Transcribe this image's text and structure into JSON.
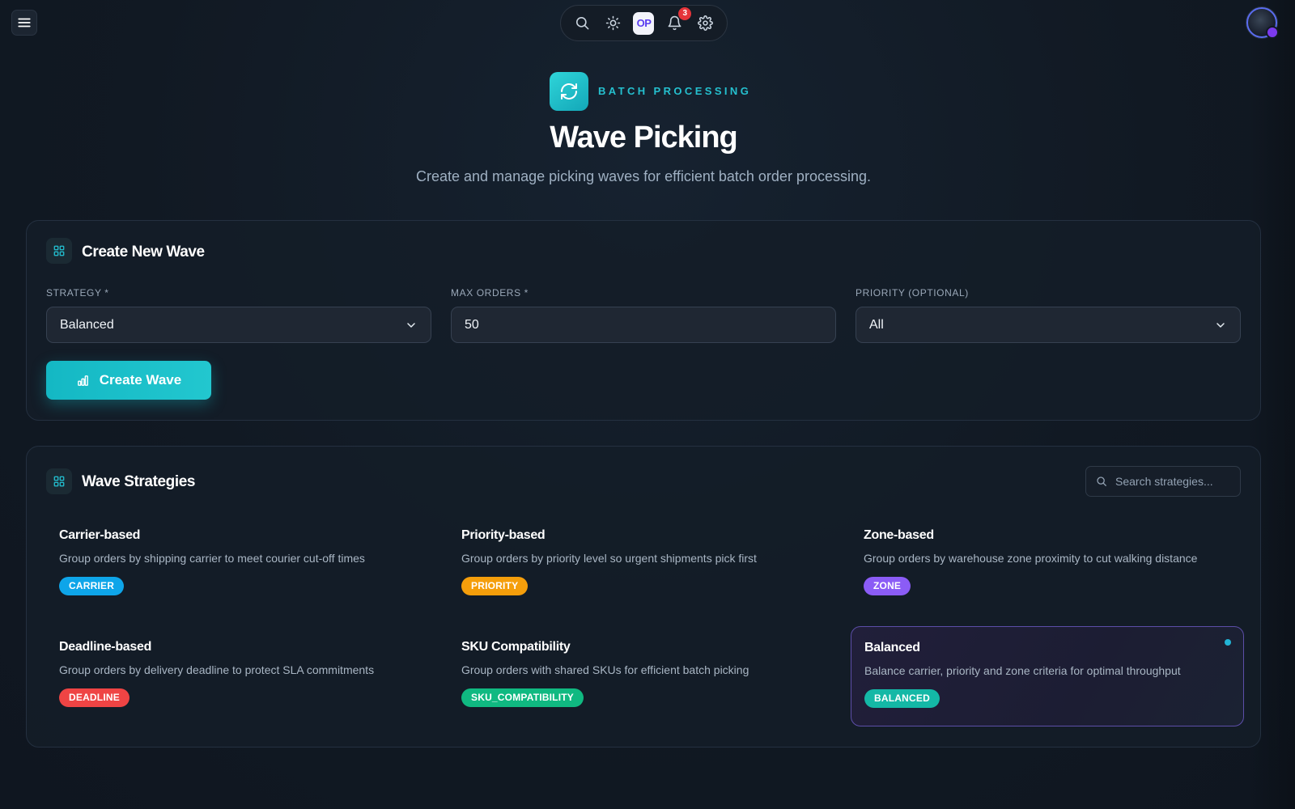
{
  "topbar": {
    "notification_count": "3",
    "logo_text": "OP",
    "icons": [
      "menu-icon",
      "search-icon",
      "sun-icon",
      "bell-icon",
      "gear-icon"
    ]
  },
  "hero": {
    "eyebrow": "BATCH PROCESSING",
    "title": "Wave Picking",
    "subtitle": "Create and manage picking waves for efficient batch order processing."
  },
  "create_wave": {
    "title": "Create New Wave",
    "strategy_label": "STRATEGY *",
    "strategy_value": "Balanced",
    "max_orders_label": "MAX ORDERS *",
    "max_orders_value": "50",
    "priority_label": "PRIORITY (OPTIONAL)",
    "priority_value": "All",
    "button_label": "Create Wave"
  },
  "strategies": {
    "title": "Wave Strategies",
    "search_placeholder": "Search strategies...",
    "items": [
      {
        "name": "Carrier-based",
        "desc": "Group orders by shipping carrier to meet courier cut-off times",
        "tag": "CARRIER",
        "color": "#0ea5e9",
        "selected": false
      },
      {
        "name": "Priority-based",
        "desc": "Group orders by priority level so urgent shipments pick first",
        "tag": "PRIORITY",
        "color": "#f59e0b",
        "selected": false
      },
      {
        "name": "Zone-based",
        "desc": "Group orders by warehouse zone proximity to cut walking distance",
        "tag": "ZONE",
        "color": "#8b5cf6",
        "selected": false
      },
      {
        "name": "Deadline-based",
        "desc": "Group orders by delivery deadline to protect SLA commitments",
        "tag": "DEADLINE",
        "color": "#ef4444",
        "selected": false
      },
      {
        "name": "SKU Compatibility",
        "desc": "Group orders with shared SKUs for efficient batch picking",
        "tag": "SKU_COMPATIBILITY",
        "color": "#10b981",
        "selected": false
      },
      {
        "name": "Balanced",
        "desc": "Balance carrier, priority and zone criteria for optimal throughput",
        "tag": "BALANCED",
        "color": "#14b8a6",
        "selected": true
      }
    ]
  },
  "colors": {
    "accent": "#14b8c4",
    "background": "#111923",
    "card": "#141d28"
  }
}
